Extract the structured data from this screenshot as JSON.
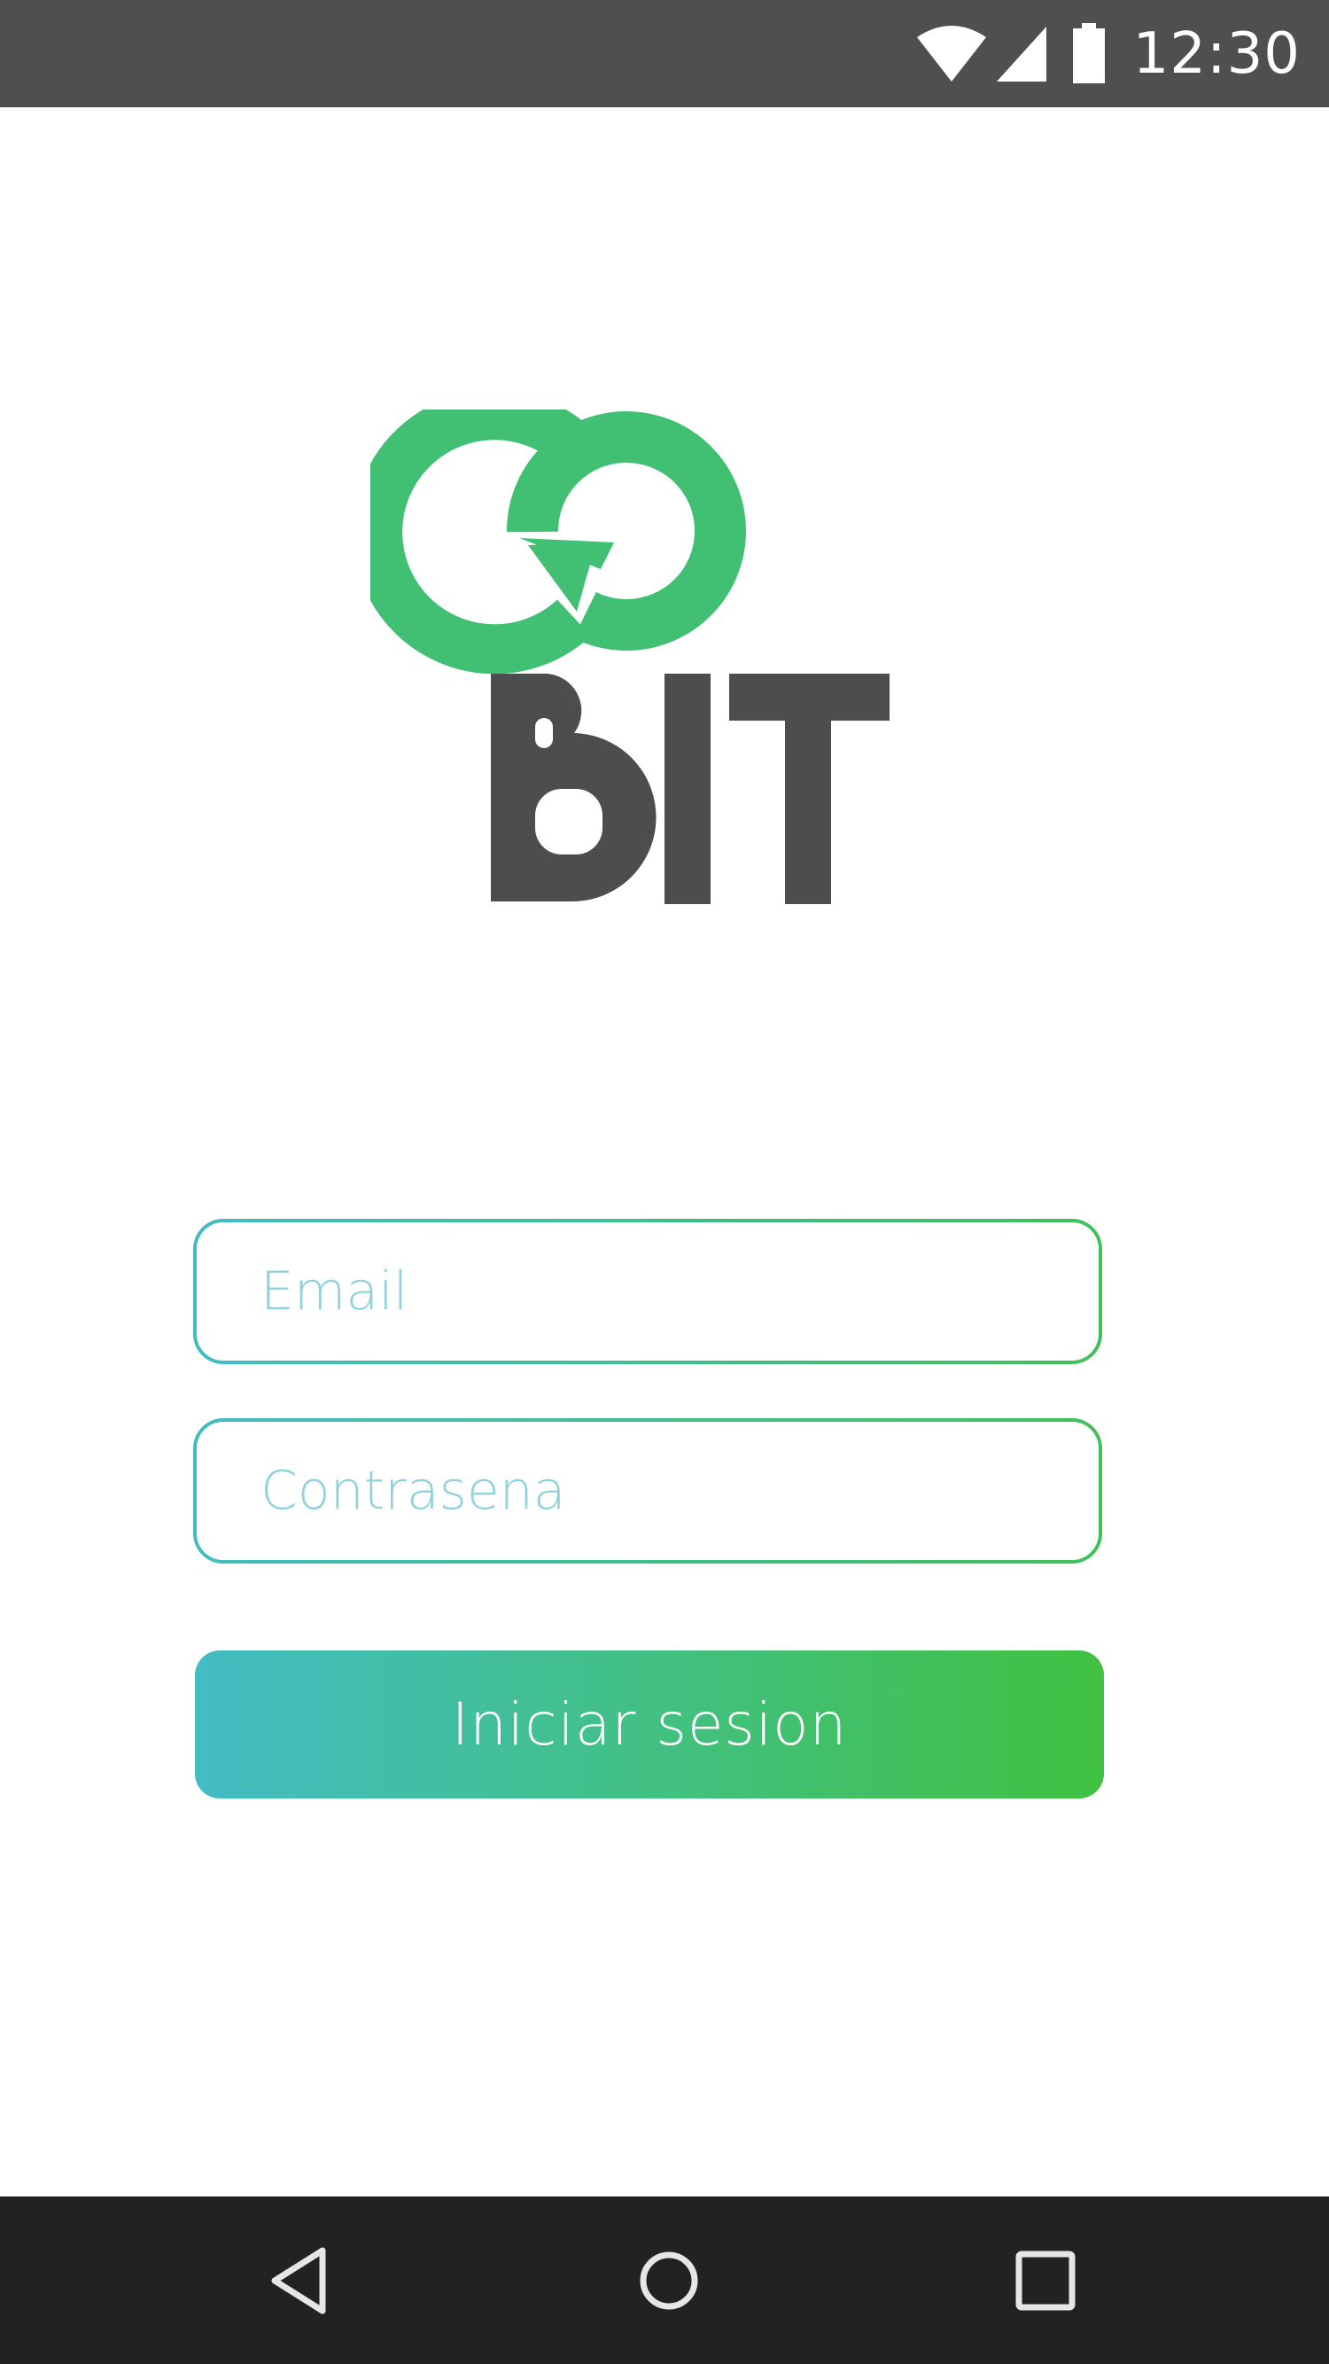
{
  "status_bar": {
    "time": "12:30",
    "icons": [
      "wifi-icon",
      "signal-icon",
      "battery-icon"
    ]
  },
  "logo": {
    "line1": "GO",
    "line2": "BIT",
    "colors": {
      "go": "#41bf73",
      "bit": "#4d4d4d"
    }
  },
  "form": {
    "email_placeholder": "Email",
    "email_value": "",
    "password_placeholder": "Contrasena",
    "password_value": "",
    "submit_label": "Iniciar sesion"
  },
  "nav_bar": {
    "icons": [
      "back-icon",
      "home-icon",
      "recents-icon"
    ]
  },
  "colors": {
    "status_bar": "#4f4f4f",
    "nav_bar": "#222222",
    "gradient_start": "#43bcc4",
    "gradient_end": "#40c141",
    "placeholder": "#8fd2dd"
  }
}
